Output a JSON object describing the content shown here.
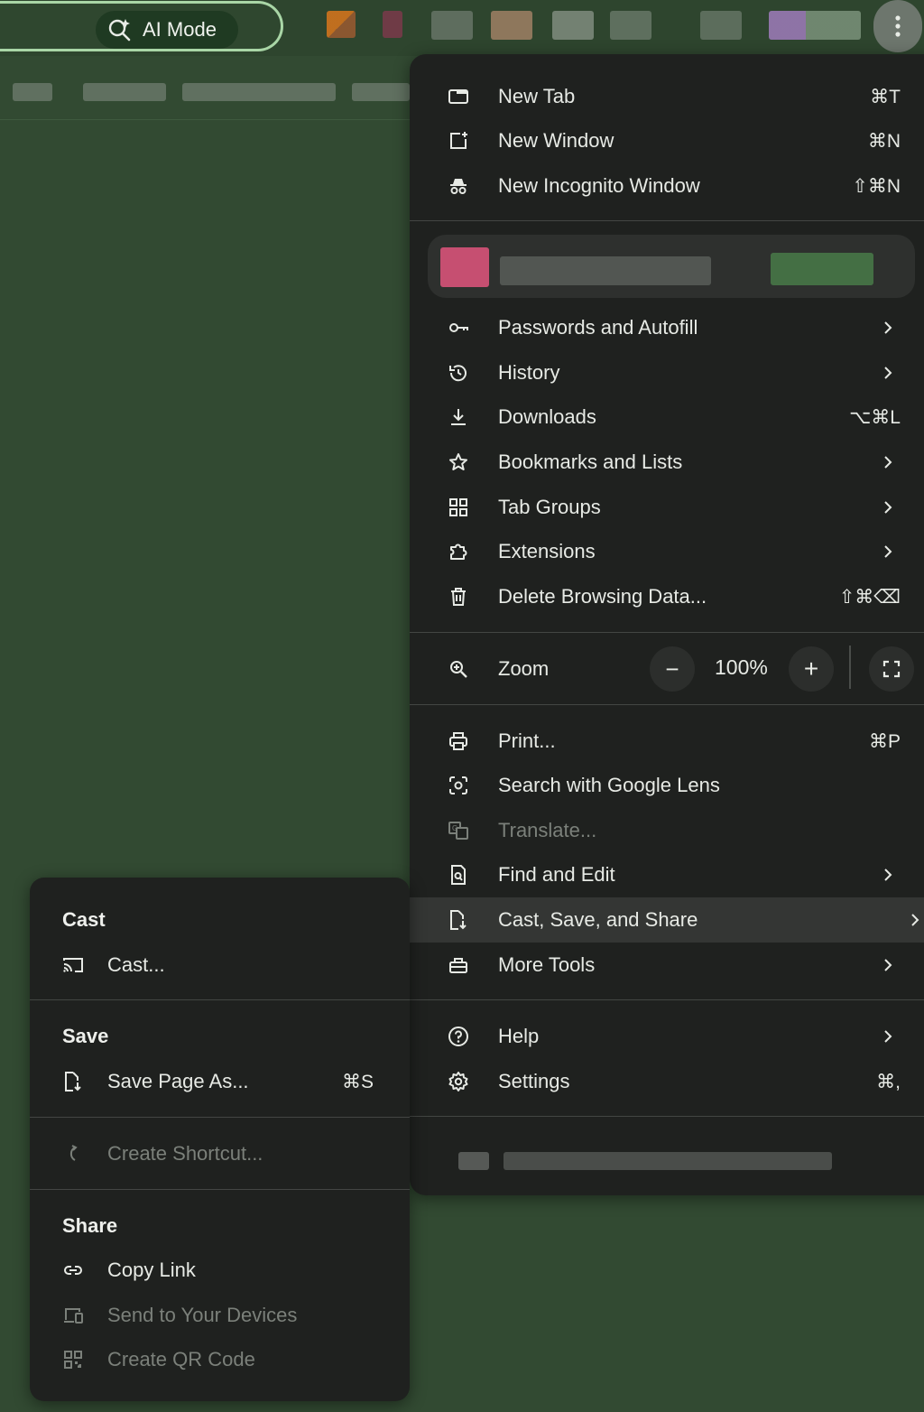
{
  "toolbar": {
    "ai_mode_label": "AI Mode"
  },
  "menu": {
    "items_top": [
      {
        "label": "New Tab",
        "shortcut": "⌘T",
        "icon": "new-tab-icon"
      },
      {
        "label": "New Window",
        "shortcut": "⌘N",
        "icon": "new-window-icon"
      },
      {
        "label": "New Incognito Window",
        "shortcut": "⇧⌘N",
        "icon": "incognito-icon"
      }
    ],
    "items_mid": [
      {
        "label": "Passwords and Autofill",
        "icon": "key-icon",
        "submenu": true
      },
      {
        "label": "History",
        "icon": "history-icon",
        "submenu": true
      },
      {
        "label": "Downloads",
        "shortcut": "⌥⌘L",
        "icon": "download-icon"
      },
      {
        "label": "Bookmarks and Lists",
        "icon": "star-icon",
        "submenu": true
      },
      {
        "label": "Tab Groups",
        "icon": "tab-groups-icon",
        "submenu": true
      },
      {
        "label": "Extensions",
        "icon": "puzzle-icon",
        "submenu": true
      },
      {
        "label": "Delete Browsing Data...",
        "shortcut": "⇧⌘⌫",
        "icon": "trash-icon"
      }
    ],
    "zoom": {
      "label": "Zoom",
      "value": "100%",
      "minus": "−",
      "plus": "+"
    },
    "items_tools": [
      {
        "label": "Print...",
        "shortcut": "⌘P",
        "icon": "print-icon"
      },
      {
        "label": "Search with Google Lens",
        "icon": "lens-icon"
      },
      {
        "label": "Translate...",
        "icon": "translate-icon",
        "disabled": true
      },
      {
        "label": "Find and Edit",
        "icon": "find-icon",
        "submenu": true
      },
      {
        "label": "Cast, Save, and Share",
        "icon": "cast-save-icon",
        "submenu": true,
        "highlighted": true
      },
      {
        "label": "More Tools",
        "icon": "toolbox-icon",
        "submenu": true
      }
    ],
    "items_bottom": [
      {
        "label": "Help",
        "icon": "help-icon",
        "submenu": true
      },
      {
        "label": "Settings",
        "shortcut": "⌘,",
        "icon": "gear-icon"
      }
    ]
  },
  "submenu": {
    "cast_heading": "Cast",
    "cast_item": "Cast...",
    "save_heading": "Save",
    "save_item": "Save Page As...",
    "save_shortcut": "⌘S",
    "shortcut_item": "Create Shortcut...",
    "share_heading": "Share",
    "copy_link": "Copy Link",
    "send_devices": "Send to Your Devices",
    "qr_code": "Create QR Code"
  }
}
